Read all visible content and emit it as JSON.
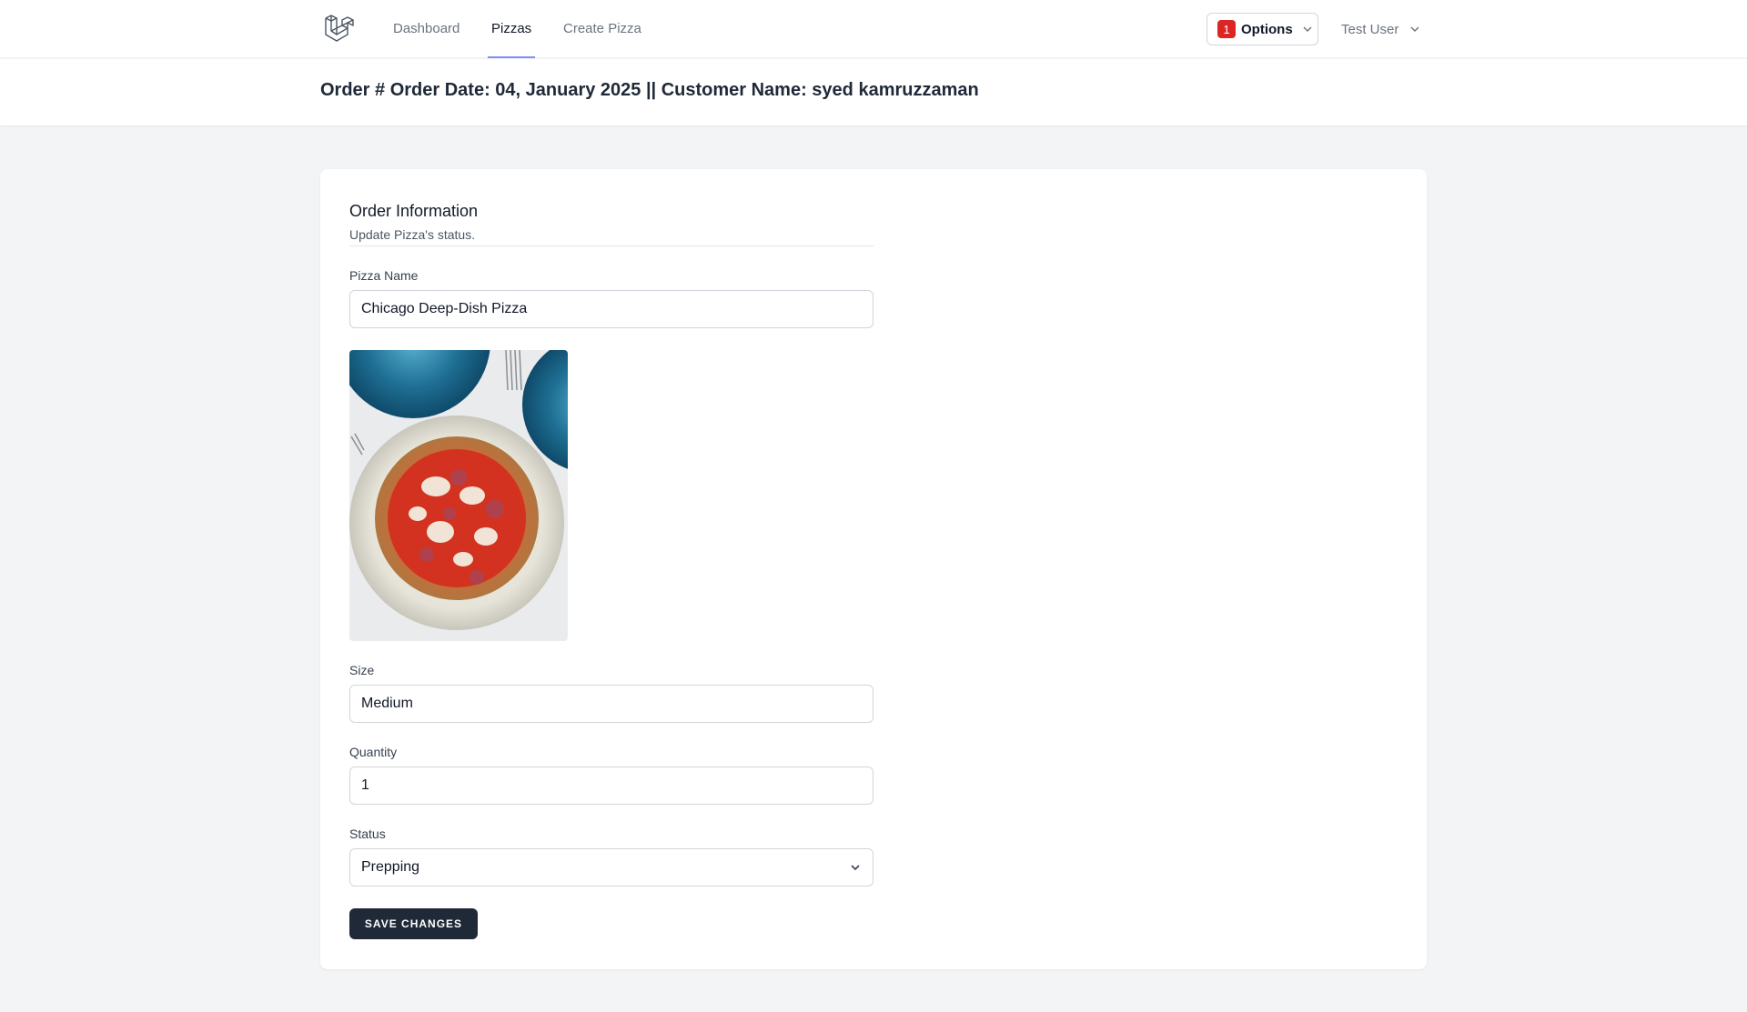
{
  "nav": {
    "links": [
      "Dashboard",
      "Pizzas",
      "Create Pizza"
    ],
    "options": {
      "badge_count": "1",
      "label": "Options"
    },
    "user_name": "Test User"
  },
  "header": {
    "title": "Order # Order Date: 04, January 2025 || Customer Name: syed kamruzzaman"
  },
  "form": {
    "section_title": "Order Information",
    "section_subtitle": "Update Pizza's status.",
    "pizza_name": {
      "label": "Pizza Name",
      "value": "Chicago Deep-Dish Pizza"
    },
    "size": {
      "label": "Size",
      "value": "Medium"
    },
    "quantity": {
      "label": "Quantity",
      "value": "1"
    },
    "status": {
      "label": "Status",
      "value": "Prepping"
    },
    "save_label": "SAVE CHANGES"
  },
  "colors": {
    "accent_underline": "#818cf8",
    "badge": "#dc2626",
    "button": "#1f2937"
  },
  "icons": {
    "logo": "laravel-logo-icon",
    "chevron": "chevron-down-icon",
    "image": "pizza-photo"
  }
}
